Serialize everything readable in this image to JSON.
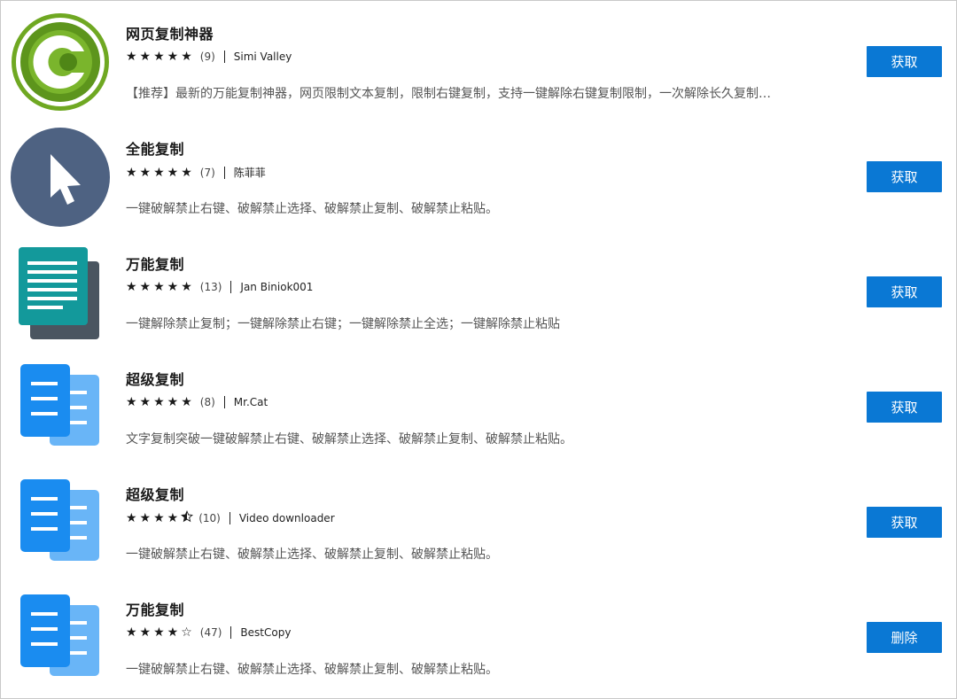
{
  "colors": {
    "button": "#0a78d4",
    "text": "#1f1f1f",
    "muted": "#555555"
  },
  "extensions": [
    {
      "icon": "copy-c-logo-icon",
      "title": "网页复制神器",
      "stars": "★★★★★",
      "rating": 5,
      "count": "(9)",
      "author": "Simi Valley",
      "description": "【推荐】最新的万能复制神器，网页限制文本复制，限制右键复制，支持一键解除右键复制限制，一次解除长久复制…",
      "button": "获取"
    },
    {
      "icon": "cursor-arrow-icon",
      "title": "全能复制",
      "stars": "★★★★★",
      "rating": 5,
      "count": "(7)",
      "author": "陈菲菲",
      "description": "一键破解禁止右键、破解禁止选择、破解禁止复制、破解禁止粘贴。",
      "button": "获取"
    },
    {
      "icon": "text-document-icon",
      "title": "万能复制",
      "stars": "★★★★★",
      "rating": 5,
      "count": "(13)",
      "author": "Jan Biniok001",
      "description": "一键解除禁止复制；一键解除禁止右键；一键解除禁止全选；一键解除禁止粘贴",
      "button": "获取"
    },
    {
      "icon": "copy-document-icon",
      "title": "超级复制",
      "stars": "★★★★★",
      "rating": 5,
      "count": "(8)",
      "author": "Mr.Cat",
      "description": "文字复制突破一键破解禁止右键、破解禁止选择、破解禁止复制、破解禁止粘贴。",
      "button": "获取"
    },
    {
      "icon": "copy-document-icon",
      "title": "超级复制",
      "stars": "★★★★",
      "half_star": "★",
      "rating": 4.5,
      "count": "(10)",
      "author": "Video downloader",
      "description": "一键破解禁止右键、破解禁止选择、破解禁止复制、破解禁止粘贴。",
      "button": "获取"
    },
    {
      "icon": "copy-document-icon",
      "title": "万能复制",
      "stars": "★★★★☆",
      "rating": 4,
      "count": "(47)",
      "author": "BestCopy",
      "description": "一键破解禁止右键、破解禁止选择、破解禁止复制、破解禁止粘贴。",
      "button": "删除"
    }
  ]
}
